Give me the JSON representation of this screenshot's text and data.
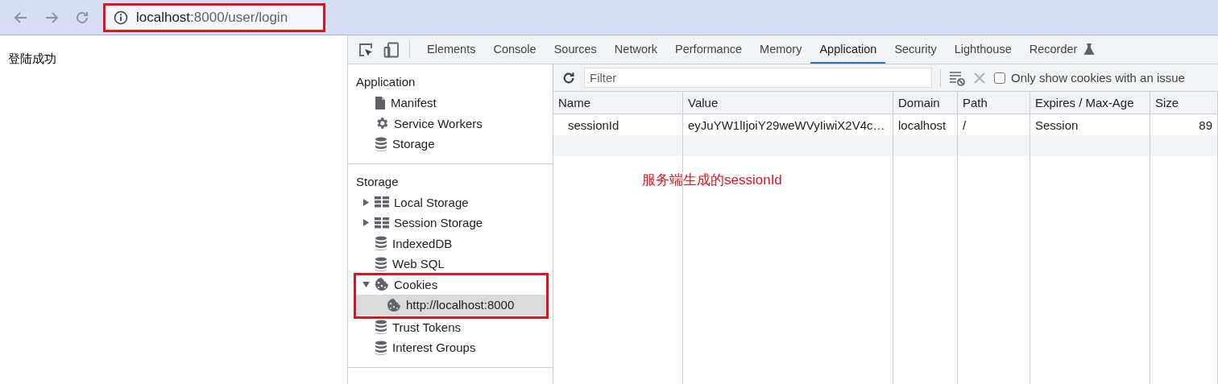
{
  "browser": {
    "url": {
      "host": "localhost",
      "path": ":8000/user/login",
      "highlighted": true
    }
  },
  "page": {
    "text": "登陆成功"
  },
  "devtools": {
    "tabs": [
      {
        "label": "Elements",
        "selected": false
      },
      {
        "label": "Console",
        "selected": false
      },
      {
        "label": "Sources",
        "selected": false
      },
      {
        "label": "Network",
        "selected": false
      },
      {
        "label": "Performance",
        "selected": false
      },
      {
        "label": "Memory",
        "selected": false
      },
      {
        "label": "Application",
        "selected": true
      },
      {
        "label": "Security",
        "selected": false
      },
      {
        "label": "Lighthouse",
        "selected": false
      },
      {
        "label": "Recorder",
        "selected": false,
        "experimental": true
      }
    ],
    "sidebar": {
      "sections": [
        {
          "title": "Application",
          "items": [
            {
              "label": "Manifest",
              "kind": "file"
            },
            {
              "label": "Service Workers",
              "kind": "gear"
            },
            {
              "label": "Storage",
              "kind": "database"
            }
          ]
        },
        {
          "title": "Storage",
          "items": [
            {
              "label": "Local Storage",
              "kind": "grid",
              "expanded": false,
              "selected": false
            },
            {
              "label": "Session Storage",
              "kind": "grid",
              "expanded": false,
              "selected": false
            },
            {
              "label": "IndexedDB",
              "kind": "database"
            },
            {
              "label": "Web SQL",
              "kind": "database"
            },
            {
              "label": "Cookies",
              "kind": "cookie",
              "expanded": true,
              "selected": false,
              "highlighted": true,
              "children": [
                {
                  "label": "http://localhost:8000",
                  "kind": "cookie",
                  "selected": true
                }
              ]
            },
            {
              "label": "Trust Tokens",
              "kind": "database"
            },
            {
              "label": "Interest Groups",
              "kind": "database"
            }
          ]
        }
      ]
    },
    "toolbar": {
      "filter": {
        "placeholder": "Filter"
      },
      "checkbox": {
        "label": "Only show cookies with an issue",
        "checked": false
      }
    },
    "table": {
      "columns": [
        "Name",
        "Value",
        "Domain",
        "Path",
        "Expires / Max-Age",
        "Size"
      ],
      "rows": [
        {
          "cells": [
            "sessionId",
            "eyJuYW1lIjoiY29weWVyIiwiX2V4c…",
            "localhost",
            "/",
            "Session",
            "89"
          ]
        }
      ]
    }
  },
  "annotation": {
    "text": "服务端生成的sessionId"
  }
}
